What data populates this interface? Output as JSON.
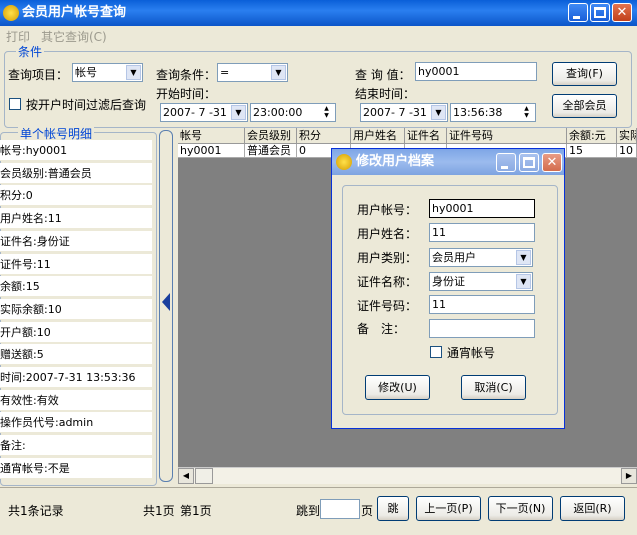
{
  "window": {
    "title": "会员用户帐号查询"
  },
  "menu": {
    "print": "打印",
    "other_query": "其它查询(C)"
  },
  "conditions": {
    "legend": "条件",
    "query_item_label": "查询项目：",
    "query_item_value": "帐号",
    "query_cond_label": "查询条件：",
    "query_cond_value": "=",
    "query_value_label": "查 询 值：",
    "query_value": "hy0001",
    "query_button": "查询(F)",
    "all_members_button": "全部会员",
    "filter_checkbox_label": "按开户时间过滤后查询",
    "start_time_label": "开始时间：",
    "start_date": "2007- 7 -31",
    "start_time": "23:00:00",
    "end_time_label": "结束时间：",
    "end_date": "2007- 7 -31",
    "end_time": "13:56:38"
  },
  "detail": {
    "legend": "单个帐号明细",
    "rows": [
      "帐号:hy0001",
      "会员级别:普通会员",
      "积分:0",
      "用户姓名:11",
      "证件名:身份证",
      "证件号:11",
      "余额:15",
      "实际余额:10",
      "开户额:10",
      "赠送额:5",
      "时间:2007-7-31 13:53:36",
      "有效性:有效",
      "操作员代号:admin",
      "备注:",
      "通宵帐号:不是"
    ]
  },
  "grid": {
    "columns": [
      "帐号",
      "会员级别",
      "积分",
      "用户姓名",
      "证件名",
      "证件号码",
      "余额:元",
      "实际"
    ],
    "rows": [
      [
        "hy0001",
        "普通会员",
        "0",
        "",
        "",
        "",
        "15",
        "10"
      ]
    ]
  },
  "footer": {
    "record_count": "共1条记录",
    "pages": "共1页",
    "current_page": "第1页",
    "jump_label": "跳到",
    "page_suffix": "页",
    "jump_button": "跳",
    "prev_button": "上一页(P)",
    "next_button": "下一页(N)",
    "back_button": "返回(R)"
  },
  "dialog": {
    "title": "修改用户档案",
    "account_label": "用户帐号：",
    "account_value": "hy0001",
    "name_label": "用户姓名：",
    "name_value": "11",
    "category_label": "用户类别：",
    "category_value": "会员用户",
    "idtype_label": "证件名称：",
    "idtype_value": "身份证",
    "idnum_label": "证件号码：",
    "idnum_value": "11",
    "remark_label": "备　注：",
    "remark_value": "",
    "overnight_label": "通宵帐号",
    "modify_button": "修改(U)",
    "cancel_button": "取消(C)"
  }
}
